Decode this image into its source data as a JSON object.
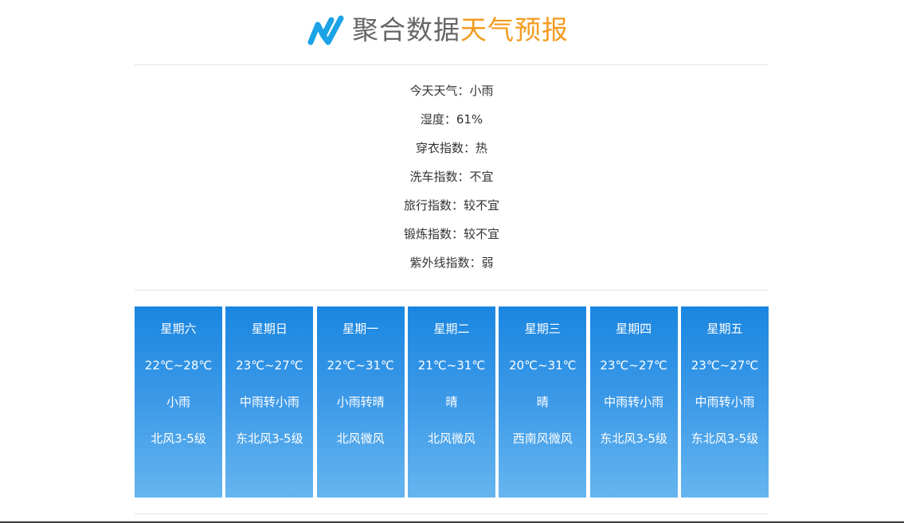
{
  "header": {
    "brand": "聚合数据",
    "product": "天气预报",
    "logo_icon": "juhe-w-logo-icon",
    "brand_color": "#666666",
    "product_color": "#f39c1f",
    "logo_color": "#1aa3e6"
  },
  "today": {
    "weather": "今天天气：小雨",
    "humidity": "湿度：61%",
    "dressing": "穿衣指数：热",
    "wash_car": "洗车指数：不宜",
    "travel": "旅行指数：较不宜",
    "exercise": "锻炼指数：较不宜",
    "uv": "紫外线指数：弱"
  },
  "forecast": [
    {
      "week": "星期六",
      "temp": "22℃~28℃",
      "weather": "小雨",
      "wind": "北风3-5级"
    },
    {
      "week": "星期日",
      "temp": "23℃~27℃",
      "weather": "中雨转小雨",
      "wind": "东北风3-5级"
    },
    {
      "week": "星期一",
      "temp": "22℃~31℃",
      "weather": "小雨转晴",
      "wind": "北风微风"
    },
    {
      "week": "星期二",
      "temp": "21℃~31℃",
      "weather": "晴",
      "wind": "北风微风"
    },
    {
      "week": "星期三",
      "temp": "20℃~31℃",
      "weather": "晴",
      "wind": "西南风微风"
    },
    {
      "week": "星期四",
      "temp": "23℃~27℃",
      "weather": "中雨转小雨",
      "wind": "东北风3-5级"
    },
    {
      "week": "星期五",
      "temp": "23℃~27℃",
      "weather": "中雨转小雨",
      "wind": "东北风3-5级"
    }
  ],
  "colors": {
    "card_top": "#1a86e0",
    "card_bottom": "#66b5ef",
    "rule": "#e2e2e2"
  }
}
